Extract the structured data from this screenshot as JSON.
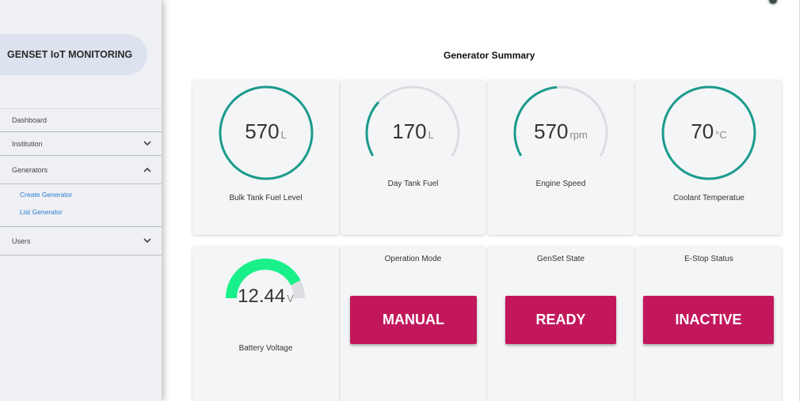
{
  "app": {
    "title": "GENSET IoT MONITORING"
  },
  "sidebar": {
    "items": [
      {
        "label": "Dashboard"
      },
      {
        "label": "Institution"
      },
      {
        "label": "Generators",
        "children": [
          {
            "label": "Create Generator"
          },
          {
            "label": "List Generator"
          }
        ]
      },
      {
        "label": "Users"
      }
    ]
  },
  "page": {
    "title": "Generator Summary"
  },
  "gauges": [
    {
      "label": "Bulk Tank Fuel Level",
      "value": "570",
      "unit": "L",
      "fraction": 1.0,
      "color": "#1a9b8c"
    },
    {
      "label": "Day Tank Fuel",
      "value": "170",
      "unit": "L",
      "fraction": 0.3,
      "color": "#1a9b8c"
    },
    {
      "label": "Engine Speed",
      "value": "570",
      "unit": "rpm",
      "fraction": 0.48,
      "color": "#1a9b8c"
    },
    {
      "label": "Coolant Temperatue",
      "value": "70",
      "unit": "°C",
      "fraction": 0.95,
      "color": "#1a9b8c"
    }
  ],
  "battery": {
    "label": "Battery Voltage",
    "value": "12.44",
    "unit": "V",
    "fraction": 0.85,
    "color": "#19f08a"
  },
  "statuses": [
    {
      "label": "Operation Mode",
      "value": "MANUAL"
    },
    {
      "label": "GenSet State",
      "value": "READY"
    },
    {
      "label": "E-Stop Status",
      "value": "INACTIVE"
    }
  ],
  "colors": {
    "status_bg": "#c2185b",
    "accent": "#1a9b8c",
    "link": "#2a7ad6"
  }
}
